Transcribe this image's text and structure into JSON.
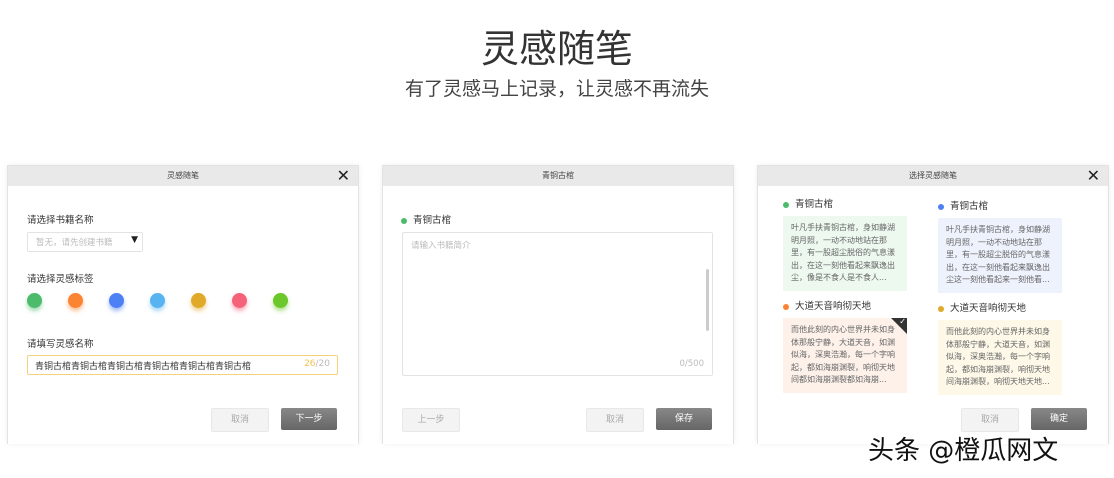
{
  "header": {
    "title": "灵感随笔",
    "subtitle": "有了灵感马上记录，让灵感不再流失"
  },
  "panel1": {
    "title": "灵感随笔",
    "book_label": "请选择书籍名称",
    "book_placeholder": "暂无，请先创建书籍",
    "tag_label": "请选择灵感标签",
    "tag_colors": [
      "#4cbb6c",
      "#fb8433",
      "#4d7ff5",
      "#57b4f1",
      "#e0a92a",
      "#f6627a",
      "#6cc72a"
    ],
    "name_label": "请填写灵感名称",
    "name_value": "青铜古棺青铜古棺青铜古棺青铜古棺青铜古棺青铜古棺",
    "count_current": "26",
    "count_max": "/20",
    "cancel": "取消",
    "next": "下一步"
  },
  "panel2": {
    "title": "青铜古棺",
    "book_name": "青铜古棺",
    "dot_color": "#4cbb6c",
    "intro_placeholder": "请输入书籍简介",
    "counter": "0/500",
    "prev": "上一步",
    "cancel": "取消",
    "save": "保存"
  },
  "panel3": {
    "title": "选择灵感随笔",
    "cards": [
      {
        "title": "青铜古棺",
        "color": "#4cbb6c",
        "bg": "#edf8ef",
        "text": "叶凡手扶青铜古棺，身如静湖明月照，一动不动地站在那里，有一股超尘脱俗的气息漾出，在这一刻他看起来飘逸出尘，像是不食人是不食人...",
        "selected": false
      },
      {
        "title": "青铜古棺",
        "color": "#4d7ff5",
        "bg": "#eef2fd",
        "text": "叶凡手扶青铜古棺，身如静湖明月照，一动不动地站在那里，有一股超尘脱俗的气息漾出，在这一刻他看起来飘逸出尘这一刻他看起来一刻他看...",
        "selected": false
      },
      {
        "title": "大道天音响彻天地",
        "color": "#fb8433",
        "bg": "#fdf1ea",
        "text": "而他此刻的内心世界并未如身体那般宁静，大道天音，如渊似海，深奥浩瀚，每一个字响起，都如海崩渊裂，响彻天地间都如海崩渊裂都如海崩...",
        "selected": true
      },
      {
        "title": "大道天音响彻天地",
        "color": "#e0a92a",
        "bg": "#fdf8e8",
        "text": "而他此刻的内心世界并未如身体那般宁静，大道天音，如渊似海，深奥浩瀚，每一个字响起，都如海崩渊裂，响彻天地间海崩渊裂，响彻天地天地...",
        "selected": false
      }
    ],
    "cancel": "取消",
    "confirm": "确定"
  },
  "watermark": "头条 @橙瓜网文"
}
